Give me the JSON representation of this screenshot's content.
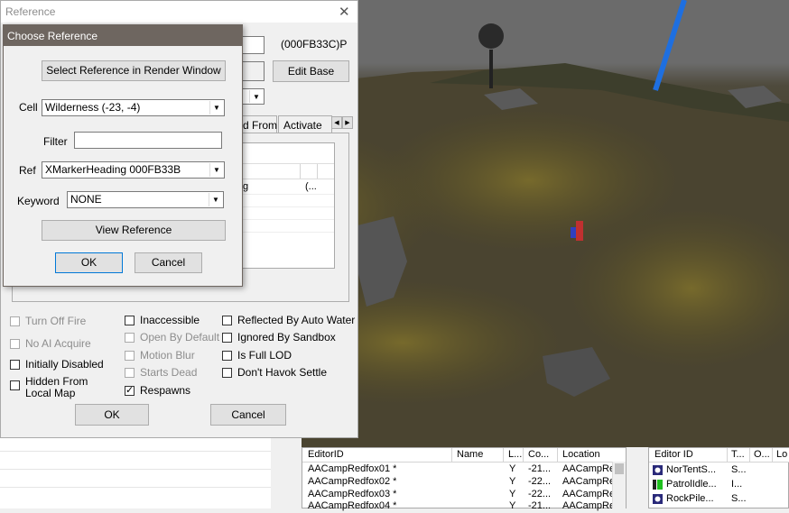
{
  "reference_window": {
    "title": "Reference",
    "close_glyph": "✕",
    "form_id": "(000FB33C)P",
    "edit_base_label": "Edit Base",
    "tab_partial_1": "d From",
    "tab_partial_2": "Activate",
    "tab_scroll_left": "◀",
    "tab_scroll_right": "▶",
    "inner_list_cell_1": "g",
    "inner_list_cell_2": "(...",
    "checkboxes": [
      {
        "label": "Turn Off Fire",
        "checked": false,
        "disabled": true
      },
      {
        "label": "No AI Acquire",
        "checked": false,
        "disabled": true
      },
      {
        "label": "Initially Disabled",
        "checked": false,
        "disabled": false
      },
      {
        "label": "Hidden From\nLocal Map",
        "checked": false,
        "disabled": false
      },
      {
        "label": "Inaccessible",
        "checked": false,
        "disabled": false
      },
      {
        "label": "Open By Default",
        "checked": false,
        "disabled": true
      },
      {
        "label": "Motion Blur",
        "checked": false,
        "disabled": true
      },
      {
        "label": "Starts Dead",
        "checked": false,
        "disabled": true
      },
      {
        "label": "Respawns",
        "checked": true,
        "disabled": false
      },
      {
        "label": "Reflected By Auto Water",
        "checked": false,
        "disabled": false
      },
      {
        "label": "Ignored By Sandbox",
        "checked": false,
        "disabled": false
      },
      {
        "label": "Is Full LOD",
        "checked": false,
        "disabled": false
      },
      {
        "label": "Don't Havok Settle",
        "checked": false,
        "disabled": false
      }
    ],
    "hidden_from_line1": "Hidden From",
    "hidden_from_line2": "Local Map",
    "ok_label": "OK",
    "cancel_label": "Cancel"
  },
  "choose_reference": {
    "title": "Choose Reference",
    "select_in_render_label": "Select Reference in Render Window",
    "cell_label": "Cell",
    "cell_value": "Wilderness (-23, -4)",
    "filter_label": "Filter",
    "filter_value": "",
    "ref_label": "Ref",
    "ref_value": "XMarkerHeading 000FB33B",
    "keyword_label": "Keyword",
    "keyword_value": "NONE",
    "view_reference_label": "View Reference",
    "ok_label": "OK",
    "cancel_label": "Cancel",
    "dropdown_glyph": "▼"
  },
  "object_list": {
    "columns": [
      "EditorID",
      "Name",
      "L...",
      "Co...",
      "Location"
    ],
    "rows": [
      {
        "editor_id": "AACampRedfox01 *",
        "name": "",
        "l": "Y",
        "co": "-21...",
        "location": "AACampRe"
      },
      {
        "editor_id": "AACampRedfox02 *",
        "name": "",
        "l": "Y",
        "co": "-22...",
        "location": "AACampRe"
      },
      {
        "editor_id": "AACampRedfox03 *",
        "name": "",
        "l": "Y",
        "co": "-22...",
        "location": "AACampRe"
      },
      {
        "editor_id": "AACampRedfox04 *",
        "name": "",
        "l": "Y",
        "co": "-21...",
        "location": "AACampRe"
      }
    ]
  },
  "cell_list": {
    "columns": [
      "Editor ID",
      "T...",
      "O...",
      "Lo"
    ],
    "rows": [
      {
        "editor_id": "NorTentS...",
        "t": "S...",
        "icon": "static-icon"
      },
      {
        "editor_id": "PatrolIdle...",
        "t": "I...",
        "icon": "marker-icon"
      },
      {
        "editor_id": "RockPile...",
        "t": "S...",
        "icon": "static-icon"
      }
    ]
  },
  "colors": {
    "title_bar_active": "#6e6660",
    "accent_blue": "#0078d7",
    "marker_blue": "#1e6fe0"
  }
}
